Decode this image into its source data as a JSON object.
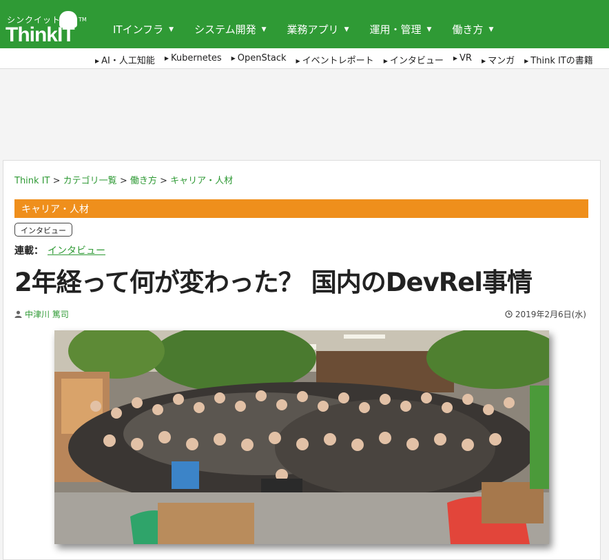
{
  "header": {
    "logo_kana": "シンクイット",
    "logo_main": "ThinkIT",
    "logo_tm": "TM",
    "nav": [
      {
        "label": "ITインフラ"
      },
      {
        "label": "システム開発"
      },
      {
        "label": "業務アプリ"
      },
      {
        "label": "運用・管理"
      },
      {
        "label": "働き方"
      }
    ],
    "colors": {
      "brand": "#2f9a35",
      "accent": "#ef8f1c"
    }
  },
  "subnav": [
    {
      "label": "AI・人工知能"
    },
    {
      "label": "Kubernetes"
    },
    {
      "label": "OpenStack"
    },
    {
      "label": "イベントレポート"
    },
    {
      "label": "インタビュー"
    },
    {
      "label": "VR"
    },
    {
      "label": "マンガ"
    },
    {
      "label": "Think ITの書籍"
    }
  ],
  "article": {
    "breadcrumb": [
      {
        "label": "Think IT"
      },
      {
        "label": "カテゴリ一覧"
      },
      {
        "label": "働き方"
      },
      {
        "label": "キャリア・人材"
      }
    ],
    "breadcrumb_sep": ">",
    "category": "キャリア・人材",
    "tag": "インタビュー",
    "series_label": "連載：",
    "series_value": "インタビュー",
    "title": "2年経って何が変わった？ 国内のDevRel事情",
    "author": "中津川 篤司",
    "date": "2019年2月6日(水)",
    "icons": {
      "author": "user-icon",
      "date": "clock-icon"
    }
  }
}
